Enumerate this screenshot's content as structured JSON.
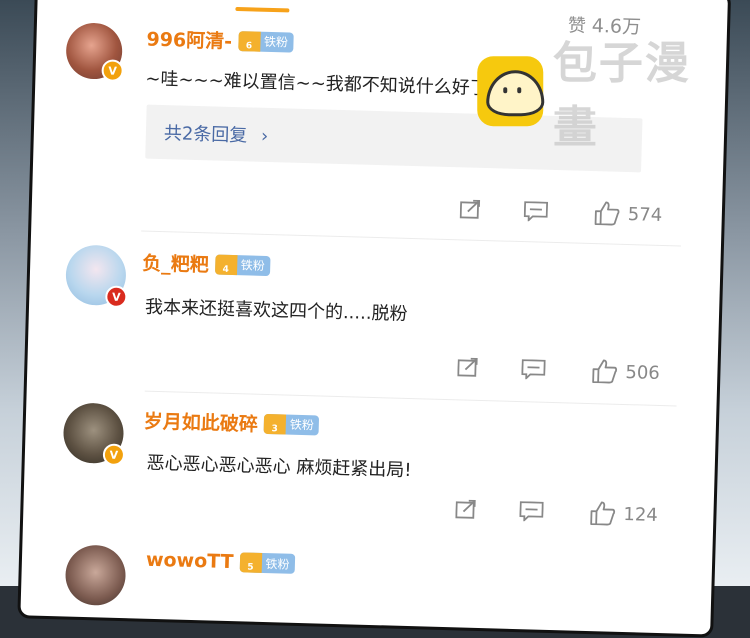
{
  "header": {
    "likes_label": "赞",
    "likes_value": "4.6万"
  },
  "watermark": {
    "text": "包子漫畫"
  },
  "comments": [
    {
      "username": "996阿清-",
      "badge_level": "6",
      "badge_text": "铁粉",
      "text": "~哇~~~难以置信~~我都不知说什么好了",
      "replies": "共2条回复",
      "likes": "574",
      "verify": "V",
      "verify_color": "#f2a10d"
    },
    {
      "username": "负_粑粑",
      "badge_level": "4",
      "badge_text": "铁粉",
      "text": "我本来还挺喜欢这四个的.....脱粉",
      "likes": "506",
      "verify": "V",
      "verify_color": "#d92b1e"
    },
    {
      "username": "岁月如此破碎",
      "badge_level": "3",
      "badge_text": "铁粉",
      "text": "恶心恶心恶心恶心 麻烦赶紧出局!",
      "likes": "124",
      "verify": "V",
      "verify_color": "#f2a10d"
    },
    {
      "username": "wowoTT",
      "badge_level": "5",
      "badge_text": "铁粉"
    }
  ],
  "colors": {
    "accent": "#f7a21a",
    "username": "#ea7a12",
    "reply_link": "#4a6aa5"
  }
}
